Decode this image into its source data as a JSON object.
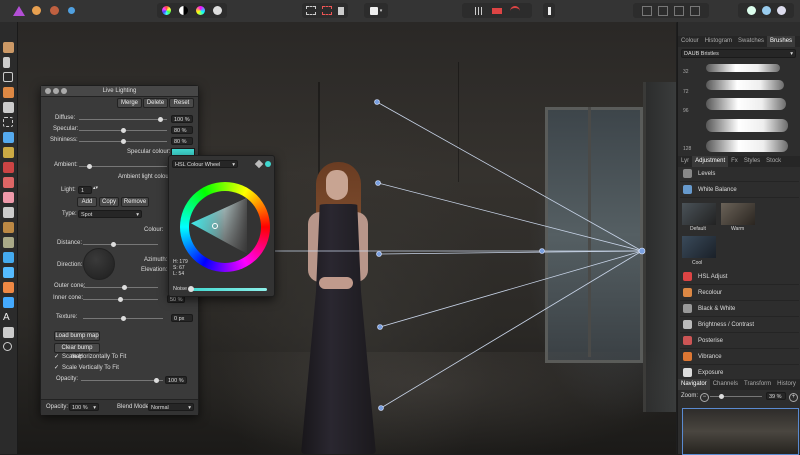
{
  "toolbar": {
    "left_icons": [
      "affinity-logo-icon",
      "develop-persona-icon",
      "liquify-persona-icon",
      "export-persona-icon"
    ],
    "mid_icons": [
      "color-balance-icon",
      "bw-icon",
      "hsl-icon",
      "contrast-icon"
    ],
    "sel_icons": [
      "marquee-icon",
      "ellipse-marquee-icon",
      "mask-icon",
      "quick-mask-icon"
    ],
    "right_icons": [
      "grid-icon",
      "snapping-icon",
      "assistant-icon",
      "arrange-icon",
      "view-icon",
      "zoom-icon",
      "mode-icon"
    ]
  },
  "live_lighting": {
    "title": "Live Lighting",
    "buttons": [
      "Merge",
      "Delete",
      "Reset"
    ],
    "diffuse": {
      "label": "Diffuse:",
      "value": "100 %",
      "level": 0.95
    },
    "specular": {
      "label": "Specular:",
      "value": "80 %",
      "level": 0.5
    },
    "shininess": {
      "label": "Shininess:",
      "value": "80 %",
      "level": 0.5
    },
    "specular_colour": "Specular colour:",
    "ambient": {
      "label": "Ambient:",
      "level": 0.1
    },
    "ambient_light_colour": "Ambient light colour:",
    "light": {
      "label": "Light:",
      "value": "1"
    },
    "light_buttons": [
      "Add",
      "Copy",
      "Remove"
    ],
    "type": {
      "label": "Type:",
      "value": "Spot"
    },
    "colour": "Colour:",
    "distance": {
      "label": "Distance:",
      "level": 0.4
    },
    "direction": "Direction:",
    "azimuth": "Azimuth:",
    "elevation": "Elevation:",
    "outer_cone": {
      "label": "Outer cone:",
      "level": 0.55
    },
    "inner_cone": {
      "label": "Inner cone:",
      "value": "50 %",
      "level": 0.5
    },
    "texture": {
      "label": "Texture:",
      "value": "0 px",
      "level": 0.5
    },
    "load_bump": "Load bump map",
    "clear_bump": "Clear bump map",
    "scale_h": "Scale Horizontally To Fit",
    "scale_v": "Scale Vertically To Fit",
    "opacity": {
      "label": "Opacity:",
      "value": "100 %",
      "level": 0.95
    },
    "footer_opacity": {
      "label": "Opacity:",
      "value": "100 %"
    },
    "blend_mode": {
      "label": "Blend Mode:",
      "value": "Normal"
    }
  },
  "hsl_popup": {
    "mode": "HSL Colour Wheel",
    "h": "H: 179",
    "s": "S: 67",
    "l": "L: 54",
    "noise": "Noise",
    "selected_color": "#40d8d0"
  },
  "brushes_panel": {
    "tabs": [
      "Colour",
      "Histogram",
      "Swatches",
      "Brushes"
    ],
    "active": "Brushes",
    "category": "DAUB Bristles",
    "sizes": [
      "32",
      "72",
      "96",
      "128"
    ]
  },
  "adjustment_panel": {
    "tabs": [
      "Lyr",
      "Adjustment",
      "Fx",
      "Styles",
      "Stock"
    ],
    "active": "Adjustment",
    "items": [
      {
        "label": "Levels",
        "color": "#888"
      },
      {
        "label": "White Balance",
        "color": "#6699cc"
      }
    ],
    "presets": [
      "Default",
      "Warm",
      "Cool"
    ],
    "items2": [
      {
        "label": "HSL Adjust",
        "color": "#d44"
      },
      {
        "label": "Recolour",
        "color": "#d84"
      },
      {
        "label": "Black & White",
        "color": "#999"
      },
      {
        "label": "Brightness / Contrast",
        "color": "#bbb"
      },
      {
        "label": "Posterise",
        "color": "#c55"
      },
      {
        "label": "Vibrance",
        "color": "#d73"
      },
      {
        "label": "Exposure",
        "color": "#ddd"
      }
    ]
  },
  "navigator_panel": {
    "tabs": [
      "Navigator",
      "Channels",
      "Transform",
      "History"
    ],
    "active": "Navigator",
    "zoom_label": "Zoom:",
    "zoom_value": "39 %",
    "zoom_level": 0.2
  }
}
